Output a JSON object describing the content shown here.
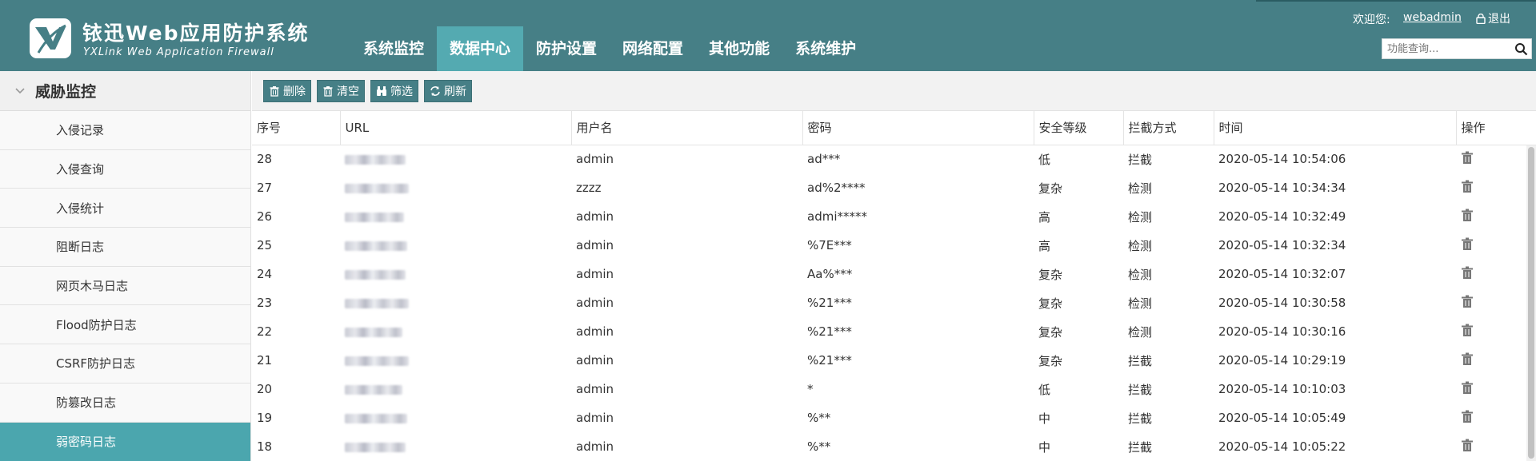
{
  "header": {
    "brand_cn": "铱迅Web应用防护系统",
    "brand_en": "YXLink Web Application Firewall",
    "welcome": "欢迎您:",
    "username": "webadmin",
    "logout": "退出",
    "search_placeholder": "功能查询..."
  },
  "nav": [
    {
      "label": "系统监控",
      "active": false
    },
    {
      "label": "数据中心",
      "active": true
    },
    {
      "label": "防护设置",
      "active": false
    },
    {
      "label": "网络配置",
      "active": false
    },
    {
      "label": "其他功能",
      "active": false
    },
    {
      "label": "系统维护",
      "active": false
    }
  ],
  "sidebar": {
    "section": "威胁监控",
    "items": [
      {
        "label": "入侵记录",
        "active": false
      },
      {
        "label": "入侵查询",
        "active": false
      },
      {
        "label": "入侵统计",
        "active": false
      },
      {
        "label": "阻断日志",
        "active": false
      },
      {
        "label": "网页木马日志",
        "active": false
      },
      {
        "label": "Flood防护日志",
        "active": false
      },
      {
        "label": "CSRF防护日志",
        "active": false
      },
      {
        "label": "防篡改日志",
        "active": false
      },
      {
        "label": "弱密码日志",
        "active": true
      }
    ]
  },
  "toolbar": {
    "delete": "删除",
    "clear": "清空",
    "filter": "筛选",
    "refresh": "刷新"
  },
  "table": {
    "columns": [
      "序号",
      "URL",
      "用户名",
      "密码",
      "安全等级",
      "拦截方式",
      "时间",
      "操作"
    ],
    "rows": [
      {
        "id": "28",
        "user": "admin",
        "password": "ad***",
        "level": "低",
        "action": "拦截",
        "time": "2020-05-14 10:54:06"
      },
      {
        "id": "27",
        "user": "zzzz",
        "password": "ad%2****",
        "level": "复杂",
        "action": "检测",
        "time": "2020-05-14 10:34:34"
      },
      {
        "id": "26",
        "user": "admin",
        "password": "admi*****",
        "level": "高",
        "action": "检测",
        "time": "2020-05-14 10:32:49"
      },
      {
        "id": "25",
        "user": "admin",
        "password": "%7E***",
        "level": "高",
        "action": "检测",
        "time": "2020-05-14 10:32:34"
      },
      {
        "id": "24",
        "user": "admin",
        "password": "Aa%***",
        "level": "复杂",
        "action": "检测",
        "time": "2020-05-14 10:32:07"
      },
      {
        "id": "23",
        "user": "admin",
        "password": "%21***",
        "level": "复杂",
        "action": "检测",
        "time": "2020-05-14 10:30:58"
      },
      {
        "id": "22",
        "user": "admin",
        "password": "%21***",
        "level": "复杂",
        "action": "检测",
        "time": "2020-05-14 10:30:16"
      },
      {
        "id": "21",
        "user": "admin",
        "password": "%21***",
        "level": "复杂",
        "action": "拦截",
        "time": "2020-05-14 10:29:19"
      },
      {
        "id": "20",
        "user": "admin",
        "password": "*",
        "level": "低",
        "action": "拦截",
        "time": "2020-05-14 10:10:03"
      },
      {
        "id": "19",
        "user": "admin",
        "password": "%**",
        "level": "中",
        "action": "拦截",
        "time": "2020-05-14 10:05:49"
      },
      {
        "id": "18",
        "user": "admin",
        "password": "%**",
        "level": "中",
        "action": "拦截",
        "time": "2020-05-14 10:05:22"
      }
    ]
  },
  "colors": {
    "header_bg": "#467f86",
    "nav_active": "#54aab1",
    "sidebar_active": "#4ba6ae"
  }
}
